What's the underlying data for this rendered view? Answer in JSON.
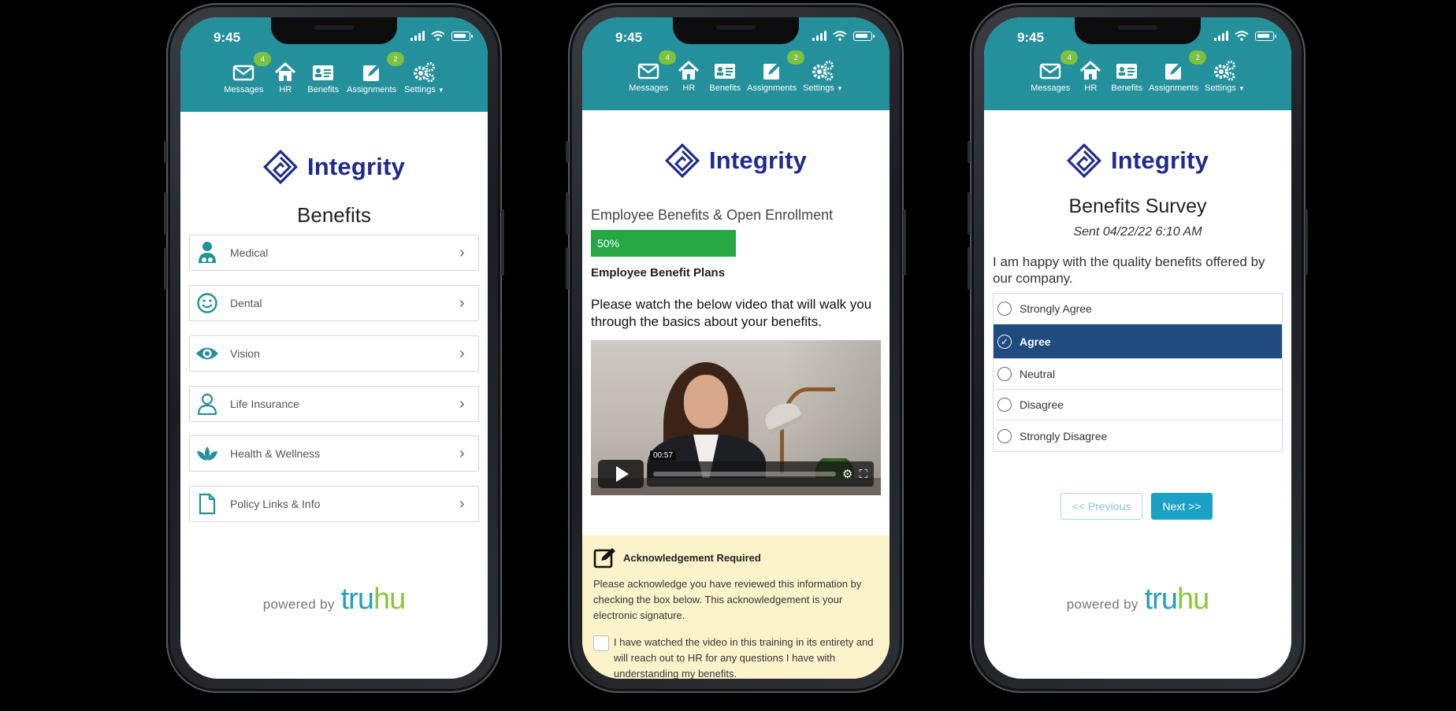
{
  "status_time": "9:45",
  "nav": {
    "messages": {
      "label": "Messages",
      "badge": "4"
    },
    "hr": {
      "label": "HR"
    },
    "benefits": {
      "label": "Benefits"
    },
    "assignments": {
      "label": "Assignments",
      "badge": "2"
    },
    "settings": {
      "label": "Settings"
    }
  },
  "brand": {
    "name": "Integrity",
    "color": "#1f2a8c"
  },
  "colors": {
    "appbar": "#23909c",
    "badge": "#7cc142",
    "selected": "#1f4b7f",
    "next": "#1ba1c6",
    "progress": "#26a744",
    "ack_bg": "#fdf3cb"
  },
  "powered": {
    "by": "powered by",
    "tru": "tru",
    "hu": "hu"
  },
  "phone1": {
    "title": "Benefits",
    "items": [
      {
        "label": "Medical",
        "icon": "doctor-icon"
      },
      {
        "label": "Dental",
        "icon": "smile-icon"
      },
      {
        "label": "Vision",
        "icon": "eye-icon"
      },
      {
        "label": "Life Insurance",
        "icon": "person-icon"
      },
      {
        "label": "Health & Wellness",
        "icon": "lotus-icon"
      },
      {
        "label": "Policy Links & Info",
        "icon": "document-icon"
      }
    ]
  },
  "phone2": {
    "section_title": "Employee Benefits & Open Enrollment",
    "progress_label": "50%",
    "progress_value": 0.5,
    "subhead": "Employee Benefit Plans",
    "instructions": "Please watch the below video that will walk you through the basics about your benefits.",
    "video_time": "00:57",
    "ack_title": "Acknowledgement Required",
    "ack_text": "Please acknowledge you have reviewed this information by checking the box below. This acknowledgement is your electronic signature.",
    "ack_checkbox_text": "I have watched the video in this training in its entirety and will reach out to HR for any questions I have with understanding my benefits."
  },
  "phone3": {
    "title": "Benefits Survey",
    "sent": "Sent 04/22/22 6:10 AM",
    "question": "I am happy with the quality benefits offered by our company.",
    "options": [
      "Strongly Agree",
      "Agree",
      "Neutral",
      "Disagree",
      "Strongly Disagree"
    ],
    "selected": "Agree",
    "prev_label": "<< Previous",
    "next_label": "Next >>"
  }
}
